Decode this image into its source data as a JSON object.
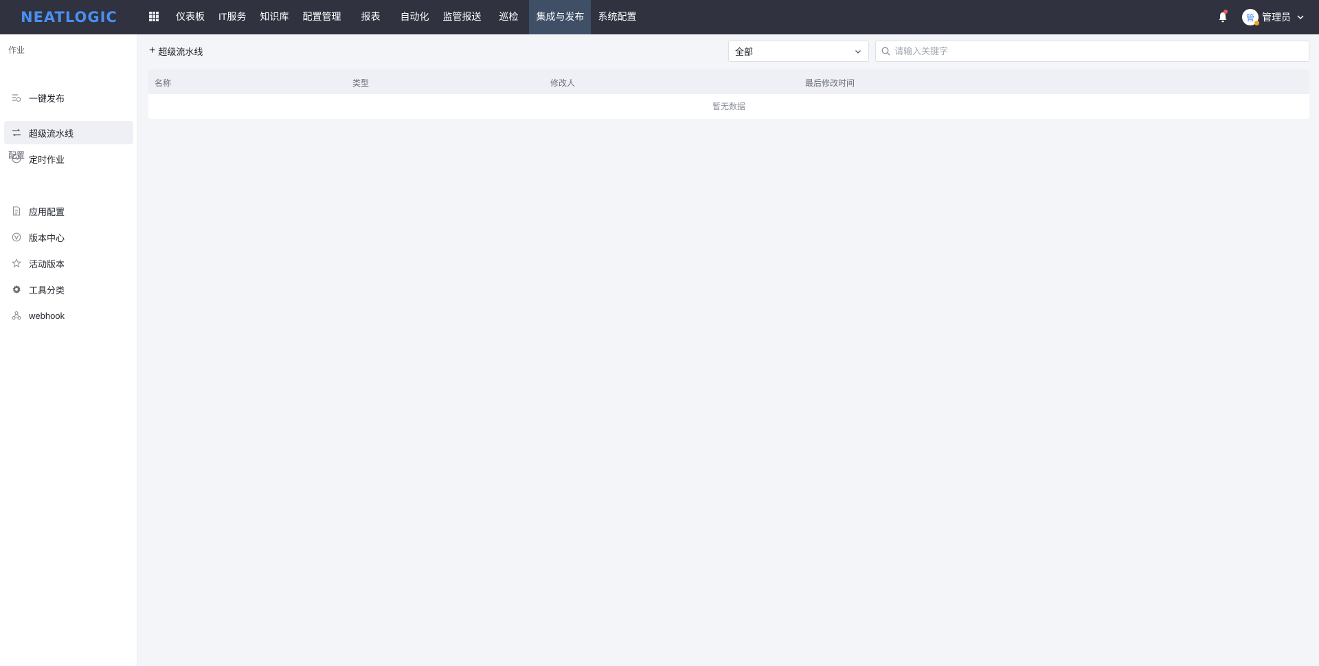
{
  "brand": {
    "logo_text": "NEATLOGIC"
  },
  "topnav": {
    "items": [
      {
        "label": "仪表板"
      },
      {
        "label": "IT服务"
      },
      {
        "label": "知识库"
      },
      {
        "label": "配置管理"
      },
      {
        "label": "报表"
      },
      {
        "label": "自动化"
      },
      {
        "label": "监管报送"
      },
      {
        "label": "巡检"
      },
      {
        "label": "集成与发布",
        "active": true
      },
      {
        "label": "系统配置"
      }
    ]
  },
  "user": {
    "avatar_text": "管",
    "name": "管理员"
  },
  "sidebar": {
    "groups": [
      {
        "title": "作业",
        "items": [
          {
            "label": "一键发布",
            "icon": "list-icon"
          },
          {
            "label": "超级流水线",
            "icon": "pipeline-icon",
            "active": true
          },
          {
            "label": "定时作业",
            "icon": "clock-icon"
          }
        ]
      },
      {
        "title": "配置",
        "items": [
          {
            "label": "应用配置",
            "icon": "document-icon"
          },
          {
            "label": "版本中心",
            "icon": "version-icon"
          },
          {
            "label": "活动版本",
            "icon": "star-icon"
          },
          {
            "label": "工具分类",
            "icon": "gear-icon"
          },
          {
            "label": "webhook",
            "icon": "webhook-icon"
          }
        ]
      }
    ]
  },
  "toolbar": {
    "add_label": "超级流水线",
    "filter_value": "全部",
    "search_placeholder": "请输入关键字"
  },
  "table": {
    "columns": [
      "名称",
      "类型",
      "修改人",
      "最后修改时间"
    ],
    "rows": [],
    "empty_text": "暂无数据"
  },
  "colors": {
    "topbar": "#30323f",
    "nav_active": "#3e4f66",
    "brand": "#4a8ff2",
    "background": "#f3f5f9"
  }
}
